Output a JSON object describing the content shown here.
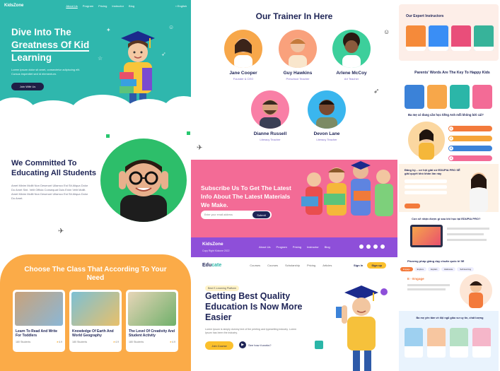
{
  "col1": {
    "hero": {
      "logo": "KidsZone",
      "nav": [
        "About Us",
        "Program",
        "Pricing",
        "Instructor",
        "Blog"
      ],
      "lang": "English",
      "title_lines": [
        "Dive Into The",
        "Greatness Of Kid",
        "Learning"
      ],
      "desc": "Lorem ipsum dolor sit amet, consectetur adipiscing elit. Cursus imperdiet sed id elementum.",
      "cta": "Join With Us"
    },
    "commit": {
      "title": "We Committed To Educating All Students",
      "desc": "Amet Minim Mollit Non Deserunt Ullamco Est Sit Aliqua Dolor Do Amet Sint. Velit Officia Consequat Duis Enim Velit Mollit. Amet Minim Mollit Non Deserunt Ullamco Est Sit Aliqua Dolor Do Amet."
    },
    "classes": {
      "title": "Choose The Class That According To Your Need",
      "cards": [
        {
          "title": "Learn To Read And Write For Toddlers",
          "students": "180 Students",
          "rating": "4.9"
        },
        {
          "title": "Knowledge Of Earth And World Geography",
          "students": "180 Students",
          "rating": "4.9"
        },
        {
          "title": "The Level Of Creativity And Student Activity",
          "students": "180 Students",
          "rating": "4.9"
        }
      ]
    }
  },
  "col2": {
    "trainers_title": "Our Trainer In Here",
    "trainers": [
      {
        "name": "Jane Cooper",
        "role": "Founder & CEO"
      },
      {
        "name": "Guy Hawkins",
        "role": "Preschool Teacher"
      },
      {
        "name": "Arlene McCoy",
        "role": "Art Teacher"
      },
      {
        "name": "Dianne Russell",
        "role": "Literacy Teacher"
      },
      {
        "name": "Devon Lane",
        "role": "Literacy Teacher"
      }
    ],
    "subscribe": {
      "title": "Subscribe Us To Get The Latest Info About The Latest Materials We Make.",
      "placeholder": "Enter your email address",
      "button": "Submit"
    },
    "footer": {
      "logo": "KidsZone",
      "copyright": "Copy Right Kidzone 2022",
      "links": [
        "About Us",
        "Program",
        "Pricing",
        "Instructor",
        "Blog"
      ]
    },
    "educate": {
      "logo_main": "Edu",
      "logo_accent": "cate",
      "nav": [
        "Courses",
        "Courses",
        "Scholarship",
        "Pricing",
        "Articles"
      ],
      "sign_in": "Sign In",
      "sign_up": "Sign up",
      "tag": "Best E-Learning Platform",
      "title": "Getting Best Quality Education Is Now More Easier",
      "desc": "Lorem Ipsum is simply dummy text of the printing and typesetting industry. Lorem Ipsum has been the industry.",
      "join": "Join Course",
      "how": "See how it works?"
    }
  },
  "col3": {
    "experts_title": "Our Expert Instructors",
    "parents_title": "Parents' Words Are The Key To Happy Kids",
    "question_title": "Ba mẹ có đang cần học tiếng Anh mỗi không bởi cái?",
    "steps": [
      "1",
      "2",
      "3",
      "4"
    ],
    "offer_title": "Đăng ký... cơ hội giải sử EDUPIA PRO SẼ giải quyết khó khăn lần này",
    "software_title": "Con sẽ nhận được gì sau khi học tại EDUPIA PRO?",
    "method_title": "Phương pháp giảng dạy chuẩn quốc tế 5E",
    "method_tabs": [
      "Engage",
      "Explore",
      "Explain",
      "Elaborate",
      "Self-learning"
    ],
    "method_heading": "E - Engage",
    "feedback_title": "Ba mẹ yên tâm về đội ngũ giảo sư uy tín, chất lượng"
  },
  "colors": {
    "teal": "#2fb7ad",
    "navy": "#1e2456",
    "green": "#2dbe6a",
    "orange": "#fbab48",
    "pink": "#f36b96",
    "purple": "#8e4fd9",
    "yellow": "#fbc02d"
  }
}
